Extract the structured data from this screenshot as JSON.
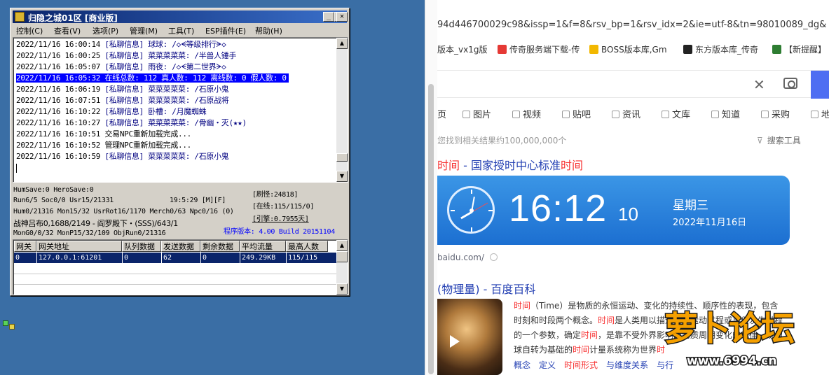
{
  "server": {
    "title": "归隐之城01区 [商业版]",
    "menu": [
      "控制(C)",
      "查看(V)",
      "选项(P)",
      "管理(M)",
      "工具(T)",
      "ESP插件(E)",
      "帮助(H)"
    ],
    "log": [
      {
        "time": "2022/11/16 16:00:14",
        "text": "[私聊信息] 球球: /◇ᗕ等级排行ᗒ◇",
        "style": "navy"
      },
      {
        "time": "2022/11/16 16:00:25",
        "text": "[私聊信息] 菜菜菜菜菜: /半兽人锤手",
        "style": "navy"
      },
      {
        "time": "2022/11/16 16:05:07",
        "text": "[私聊信息] 雨夜: /◇ᗕ第二世界ᗒ◇",
        "style": "navy"
      },
      {
        "time": "2022/11/16 16:05:32",
        "text": "在线总数: 112 真人数: 112 离线数: 0 假人数: 0",
        "style": "sel"
      },
      {
        "time": "2022/11/16 16:06:19",
        "text": "[私聊信息] 菜菜菜菜菜: /石原小鬼",
        "style": "navy"
      },
      {
        "time": "2022/11/16 16:07:51",
        "text": "[私聊信息] 菜菜菜菜菜: /石原战将",
        "style": "navy"
      },
      {
        "time": "2022/11/16 16:10:22",
        "text": "[私聊信息] 卧槽: /月魔蜘蛛",
        "style": "navy"
      },
      {
        "time": "2022/11/16 16:10:27",
        "text": "[私聊信息] 菜菜菜菜菜: /骨幽・灭(★★)",
        "style": "navy"
      },
      {
        "time": "2022/11/16 16:10:51",
        "text": "交易NPC重新加载完成...",
        "style": "blk"
      },
      {
        "time": "2022/11/16 16:10:52",
        "text": "管理NPC重新加载完成...",
        "style": "blk"
      },
      {
        "time": "2022/11/16 16:10:59",
        "text": "[私聊信息] 菜菜菜菜菜: /石原小鬼",
        "style": "navy"
      }
    ],
    "status": {
      "l1": "HumSave:0 HeroSave:0",
      "l2a": "Run6/5 Soc0/0 Usr15/21331",
      "l2b": "19:5:29 [M][F]",
      "l3": "Hum0/21316 Mon15/32 UsrRot16/1170 Merch0/63 Npc0/16 (0)",
      "l4": "战神吕布0,1688/2149 - 阎罗殿下・(SSS)/643/1",
      "l5": "MonG0/0/32 MonP15/32/109 ObjRun0/21316",
      "r1": "[刷怪:24818]",
      "r2": "[在线:115/115/0]",
      "r3": "[引擎:0.7955天]",
      "version": "程序版本: 4.00 Build 20151104"
    },
    "grid": {
      "headers": [
        "网关",
        "网关地址",
        "队列数据",
        "发送数据",
        "剩余数据",
        "平均流量",
        "最高人数"
      ],
      "rows": [
        [
          "0",
          "127.0.0.1:61201",
          "0",
          "62",
          "0",
          "249.29KB",
          "115/115"
        ]
      ]
    }
  },
  "browser": {
    "address": "94d446700029c98&issp=1&f=8&rsv_bp=1&rsv_idx=2&ie=utf-8&tn=98010089_dg&",
    "bookmarks": [
      {
        "label": "版本_vx1g版",
        "color": "#ffffff"
      },
      {
        "label": "传奇服务端下载-传",
        "color": "#e53935"
      },
      {
        "label": "BOSS版本库,Gm",
        "color": "#f2b800"
      },
      {
        "label": "东方版本库_传奇",
        "color": "#222222"
      },
      {
        "label": "【新提醒】",
        "color": "#2e7d32"
      }
    ],
    "tabs": [
      "页",
      "图片",
      "视频",
      "贴吧",
      "资讯",
      "文库",
      "知道",
      "采购",
      "地"
    ],
    "result_count": "您找到相关结果约100,000,000个",
    "tools": "搜索工具",
    "result1": {
      "pre": "时间",
      "mid": " - 国家授时中心标准",
      "post": "时间"
    },
    "clock": {
      "time": "16:12",
      "seconds": "10",
      "weekday": "星期三",
      "date": "2022年11月16日"
    },
    "source": "baidu.com/",
    "result2": "(物理量) - 百度百科",
    "snippet": [
      [
        {
          "t": "时间",
          "em": true
        },
        {
          "t": "（Time）是物质的永恒运动、变化的持续性、顺序性的表现，包含",
          "em": false
        }
      ],
      [
        {
          "t": "时刻和时段两个概念。",
          "em": false
        },
        {
          "t": "时间",
          "em": true
        },
        {
          "t": "是人类用以描述物质运动过程或事件发生过程",
          "em": false
        }
      ],
      [
        {
          "t": "的一个参数，确定",
          "em": false
        },
        {
          "t": "时间",
          "em": true
        },
        {
          "t": "，是靠不受外界影响的物质周期变化的规律。以地",
          "em": false
        }
      ],
      [
        {
          "t": "球自转为基础的",
          "em": false
        },
        {
          "t": "时间",
          "em": true
        },
        {
          "t": "计量系统称为世界",
          "em": false
        },
        {
          "t": "时",
          "em": true
        }
      ]
    ],
    "links": [
      {
        "t": "概念",
        "em": false
      },
      {
        "t": "定义",
        "em": false
      },
      {
        "t": "时间形式",
        "em": true
      },
      {
        "t": "与维度关系",
        "em": false
      },
      {
        "t": "与行",
        "em": false
      }
    ]
  },
  "watermark": {
    "logo": "萝卜论坛",
    "url": "www.6994.cn"
  }
}
